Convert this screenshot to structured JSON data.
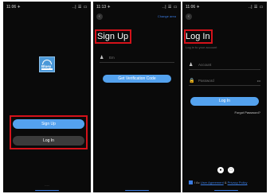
{
  "screens": [
    {
      "status_time": "11:06 ✈",
      "status_icons": "..| ☰ ▭",
      "logo_text": "Bluey",
      "signup_button": "Sign Up",
      "login_button": "Log In",
      "footer": "....."
    },
    {
      "status_time": "11:13 ✈",
      "status_icons": "..| ☰ ▭",
      "back_icon": "‹",
      "top_link": "Change area",
      "title": "Sign Up",
      "field_icon": "user-icon",
      "field_placeholder": "Em",
      "code_button": "Get Verification Code"
    },
    {
      "status_time": "11:06 ✈",
      "status_icons": "..| ☰ ▭",
      "back_icon": "‹",
      "title": "Log In",
      "subtitle": "Log in to your account",
      "account_placeholder": "Account",
      "password_placeholder": "Password",
      "eye_icon": "•••",
      "login_button": "Log In",
      "forgot": "Forgot Password?",
      "terms_prefix": "I Ac",
      "terms_link1": "User Agreement",
      "terms_mid": " & ",
      "terms_link2": "Privacy Policy"
    }
  ]
}
